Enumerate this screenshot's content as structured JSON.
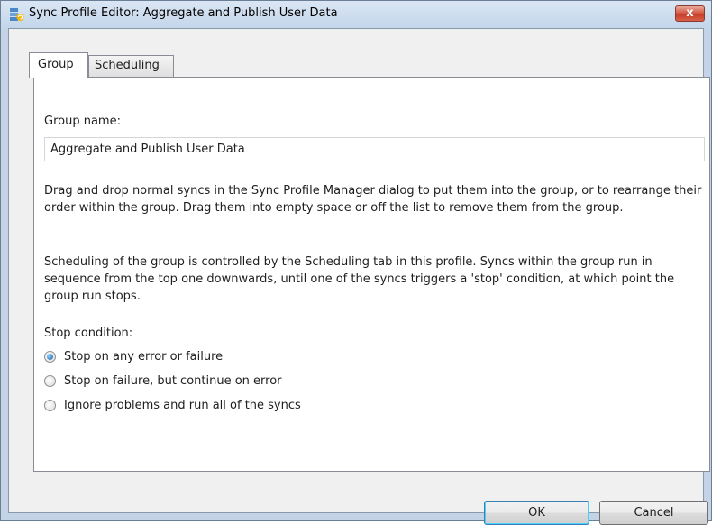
{
  "window": {
    "title": "Sync Profile Editor: Aggregate and Publish User Data",
    "app_icon": "sync-profile-icon",
    "close_glyph": "x"
  },
  "tabs": [
    {
      "label": "Group",
      "active": true
    },
    {
      "label": "Scheduling",
      "active": false
    }
  ],
  "group": {
    "name_label": "Group name:",
    "name_value": "Aggregate and Publish User Data",
    "description_1": "Drag and drop normal syncs in the Sync Profile Manager dialog to put them into the group, or to rearrange their order within the group.  Drag them into empty space or off the list to remove them from the group.",
    "description_2": "Scheduling of the group is controlled by the Scheduling tab in this profile.  Syncs within the group run in sequence from the top one downwards, until one of the syncs triggers a 'stop' condition, at which point the group run stops.",
    "stop_condition_label": "Stop condition:",
    "stop_options": [
      {
        "label": "Stop on any error or failure",
        "checked": true
      },
      {
        "label": "Stop on failure, but continue on error",
        "checked": false
      },
      {
        "label": "Ignore problems and run all of the syncs",
        "checked": false
      }
    ]
  },
  "buttons": {
    "ok": "OK",
    "cancel": "Cancel"
  },
  "colors": {
    "window_frame": "#c4d3e6",
    "close_button": "#c23a26",
    "dialog_background": "#f0f0f0",
    "default_button_border": "#3c7fb1"
  }
}
